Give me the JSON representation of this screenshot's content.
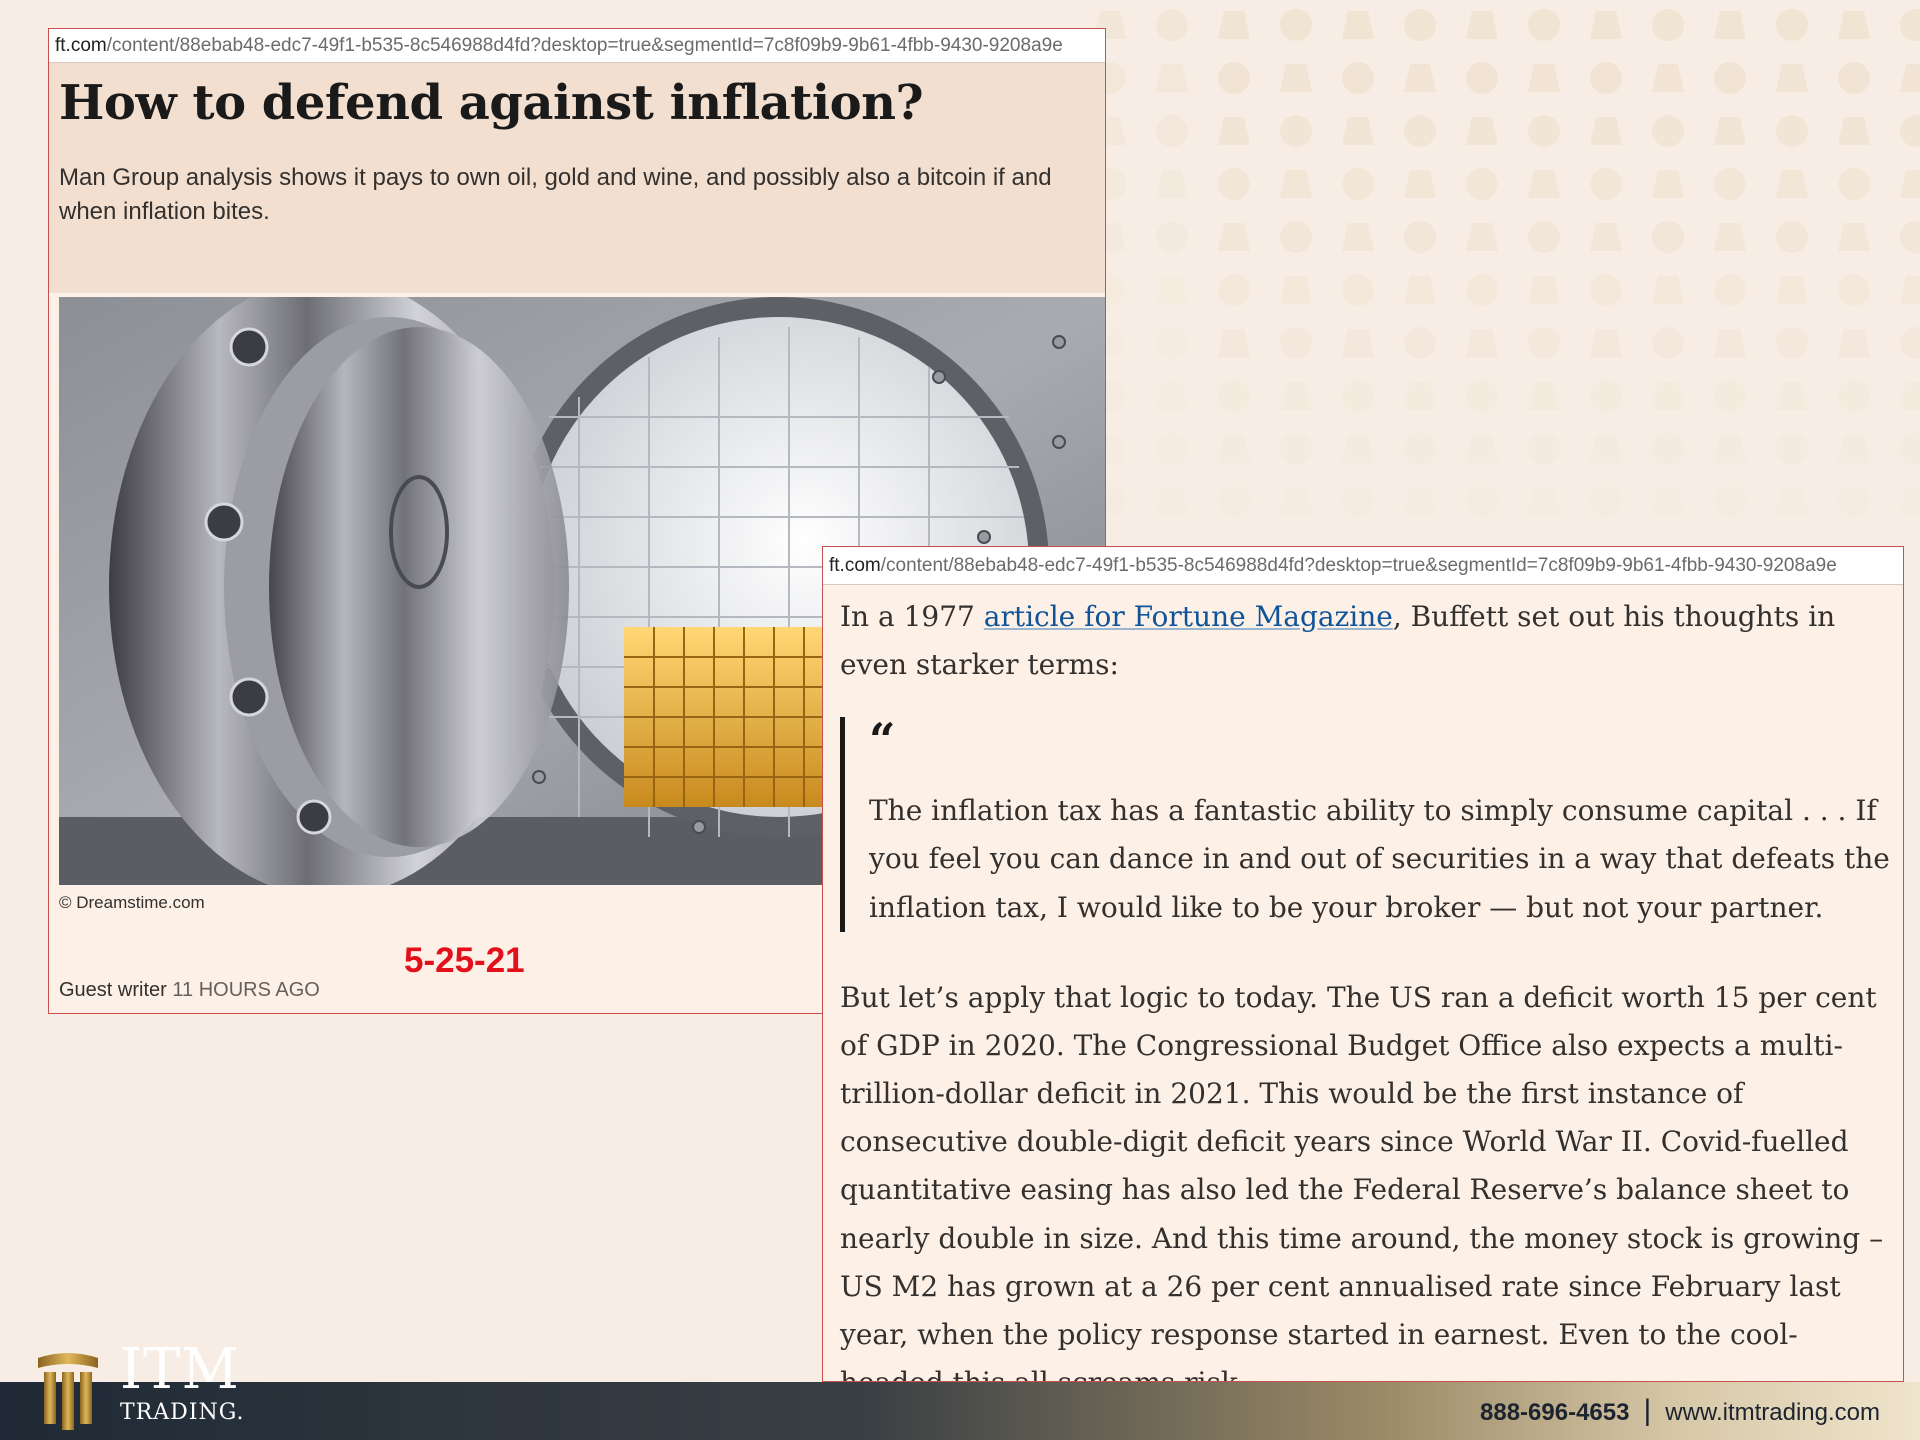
{
  "shot1": {
    "url_host": "ft.com",
    "url_path": "/content/88ebab48-edc7-49f1-b535-8c546988d4fd?desktop=true&segmentId=7c8f09b9-9b61-4fbb-9430-9208a9e",
    "title": "How to defend against inflation?",
    "subtitle": "Man Group analysis shows it pays to own oil, gold and wine, and possibly also a bitcoin if and when inflation bites.",
    "image_caption": "© Dreamstime.com",
    "date_stamp": "5-25-21",
    "byline_author": "Guest writer",
    "byline_time": "11 HOURS AGO"
  },
  "shot2": {
    "url_host": "ft.com",
    "url_path": "/content/88ebab48-edc7-49f1-b535-8c546988d4fd?desktop=true&segmentId=7c8f09b9-9b61-4fbb-9430-9208a9e",
    "intro_before": "In a 1977 ",
    "intro_link": "article for Fortune Magazine",
    "intro_after": ", Buffett set out his thoughts in even starker terms:",
    "quote_mark": "“",
    "quote": "The inflation tax has a fantastic ability to simply consume capital . . . If you feel you can dance in and out of securities in a way that defeats the inflation tax, I would like to be your broker — but not your partner.",
    "paragraph": "But let’s apply that logic to today. The US ran a deficit worth 15 per cent of GDP in 2020. The Congressional Budget Office also expects a multi-trillion-dollar deficit in 2021. This would be the first instance of consecutive double-digit deficit years since World War II. Covid-fuelled quantitative easing has also led the Federal Reserve’s balance sheet to nearly double in size. And this time around, the money stock is growing – US M2 has grown at a 26 per cent annualised rate since February last year, when the policy response started in earnest. Even to the cool-headed this all screams risk."
  },
  "footer": {
    "logo_main": "ITM",
    "logo_sub": "TRADING.",
    "phone": "888-696-4653",
    "separator": "|",
    "website": "www.itmtrading.com"
  },
  "colors": {
    "background": "#f7ede4",
    "frame_border": "#c8504f",
    "date_red": "#e3101b",
    "link_blue": "#0f5499",
    "gold": "#c89b3c"
  }
}
